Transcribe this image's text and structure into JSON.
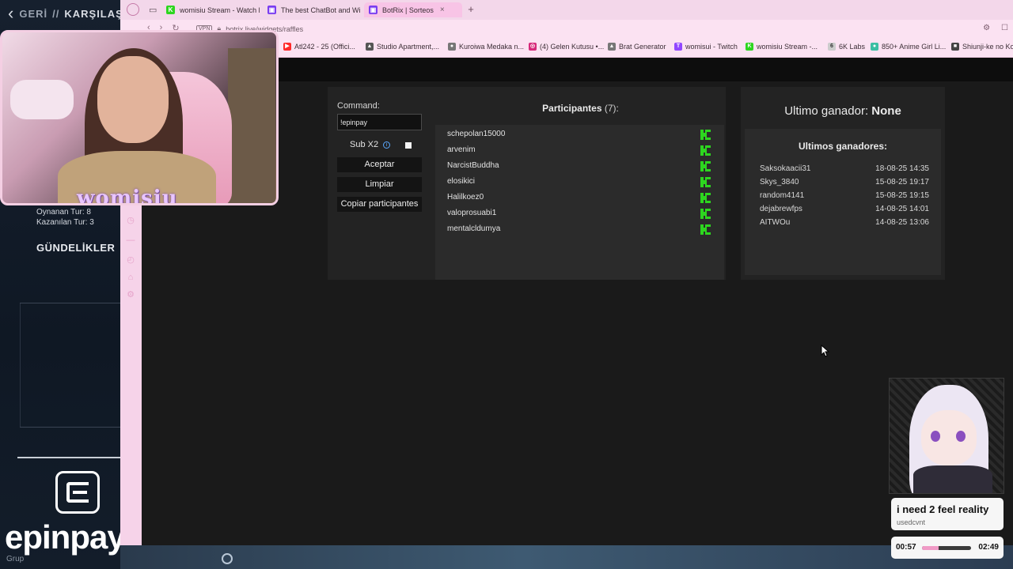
{
  "game": {
    "back_label": "GERİ",
    "separator": "//",
    "section": "KARŞILAŞ",
    "stats_played": "Oynanan Tur: 8",
    "stats_won": "Kazanılan Tur: 3",
    "daily_title": "GÜNDELİKLER",
    "brand": "epinpay",
    "footer": "Grup"
  },
  "browser": {
    "tabs": [
      {
        "label": "womisiu Stream - Watch l",
        "icon": "kick-icon",
        "color": "#2dd61f"
      },
      {
        "label": "The best ChatBot and Wi",
        "icon": "botrix-icon",
        "color": "#7a3df0"
      },
      {
        "label": "BotRix | Sorteos",
        "icon": "botrix-icon",
        "color": "#7a3df0"
      }
    ],
    "url": "botrix.live/widgets/raffles",
    "vpn_label": "VPN",
    "bookmarks": [
      {
        "label": "Atl242 - 25 (Offici...",
        "icon": "youtube-icon",
        "color": "#ff2a2a"
      },
      {
        "label": "Studio Apartment,...",
        "icon": "bookmark-icon",
        "color": "#555555"
      },
      {
        "label": "Kuroiwa Medaka n...",
        "icon": "bookmark-icon",
        "color": "#777777"
      },
      {
        "label": "(4) Gelen Kutusu •...",
        "icon": "instagram-icon",
        "color": "#d6297a"
      },
      {
        "label": "Brat Generator",
        "icon": "bookmark-icon",
        "color": "#777777"
      },
      {
        "label": "womisui - Twitch",
        "icon": "twitch-icon",
        "color": "#9146ff"
      },
      {
        "label": "womisiu Stream -...",
        "icon": "kick-icon",
        "color": "#2dd61f"
      },
      {
        "label": "6K Labs",
        "icon": "bookmark-icon",
        "color": "#cccccc"
      },
      {
        "label": "850+ Anime Girl Li...",
        "icon": "bookmark-icon",
        "color": "#3bbfa4"
      },
      {
        "label": "Shiunji-ke no Ko",
        "icon": "bookmark-icon",
        "color": "#444444"
      }
    ]
  },
  "raffle": {
    "command_label": "Command:",
    "command_value": "!epinpay",
    "sub_label": "Sub X2",
    "accept_label": "Aceptar",
    "clear_label": "Limpiar",
    "copy_label": "Copiar participantes",
    "participants_title": "Participantes",
    "participants_count": "(7):",
    "participants": [
      "schepolan15000",
      "arvenim",
      "NarcistBuddha",
      "elosikici",
      "Halilkoez0",
      "valoprosuabi1",
      "mentalcldumya"
    ],
    "last_winner_label": "Ultimo ganador:",
    "last_winner_value": "None",
    "recent_winners_title": "Ultimos ganadores:",
    "recent_winners": [
      {
        "name": "Saksokaacii31",
        "date": "18-08-25 14:35"
      },
      {
        "name": "Skys_3840",
        "date": "15-08-25 19:17"
      },
      {
        "name": "random4141",
        "date": "15-08-25 19:15"
      },
      {
        "name": "dejabrewfps",
        "date": "14-08-25 14:01"
      },
      {
        "name": "AITWOu",
        "date": "14-08-25 13:06"
      }
    ]
  },
  "overlay": {
    "webcam_name": "womisiu",
    "song_title": "i need 2 feel reality",
    "song_artist": "usedcvnt",
    "time_now": "00:57",
    "time_end": "02:49",
    "progress": 0.34,
    "accent": "#f09ac6"
  }
}
